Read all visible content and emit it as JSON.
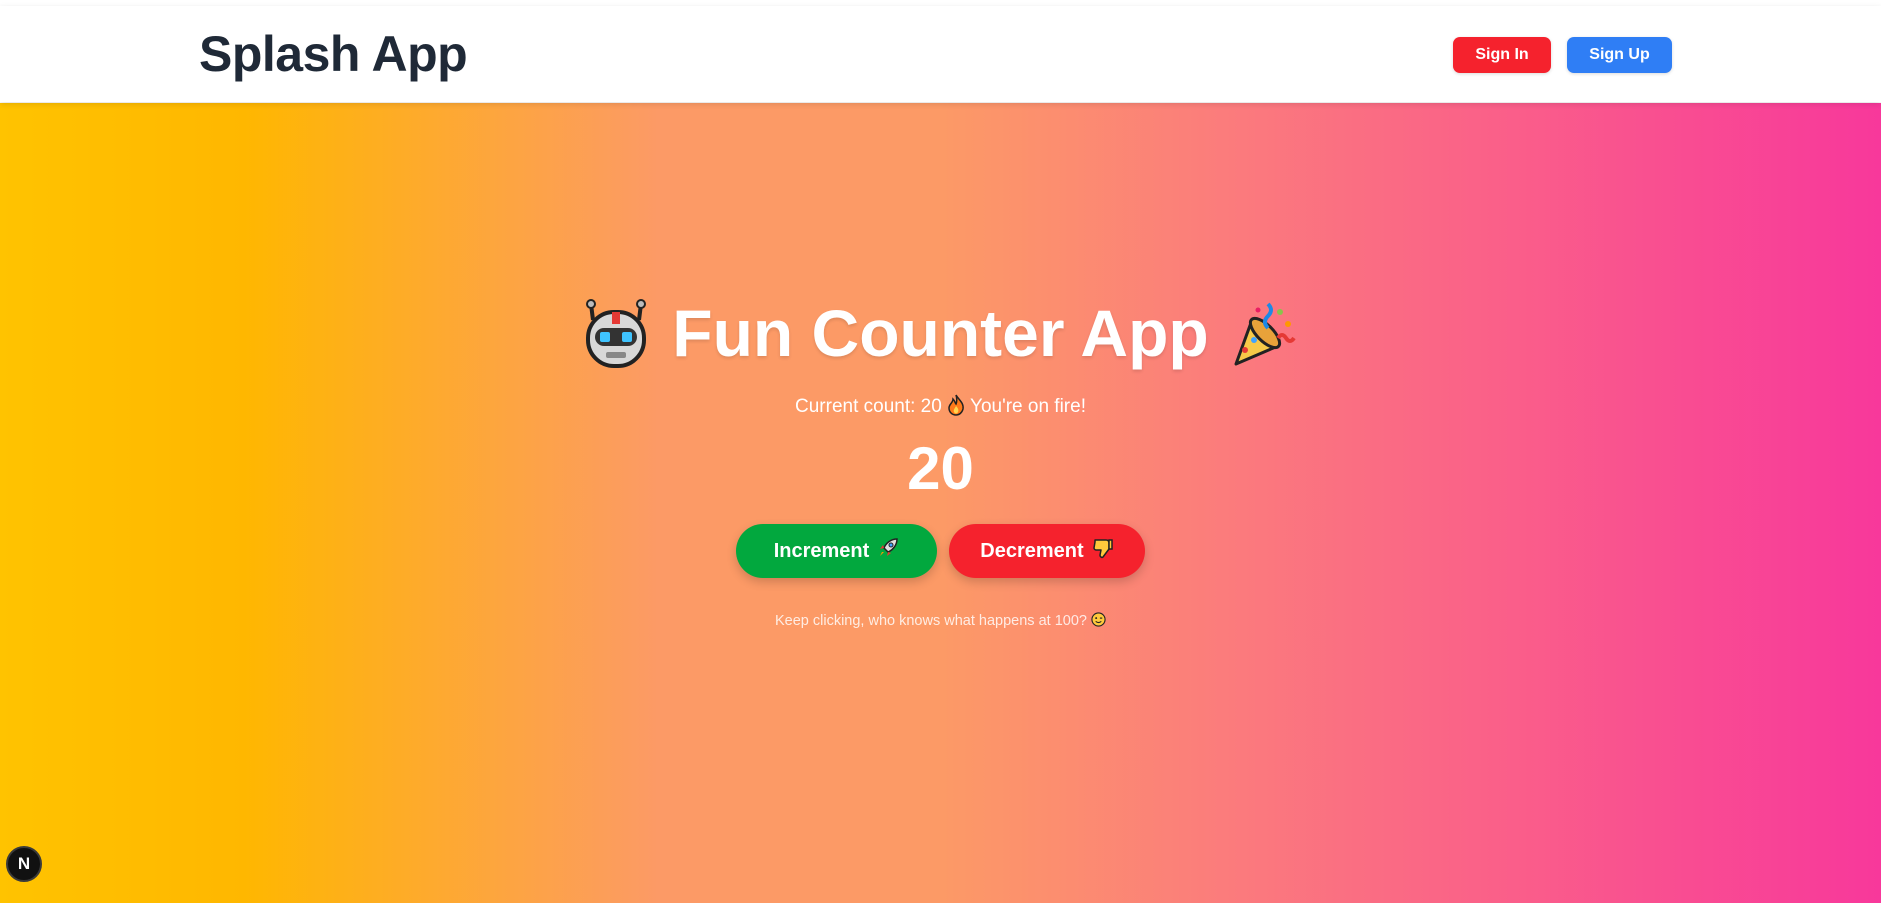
{
  "header": {
    "brand": "Splash App",
    "sign_in_label": "Sign In",
    "sign_up_label": "Sign Up",
    "sign_in_color": "#f5222d",
    "sign_up_color": "#2f7ef5"
  },
  "hero": {
    "title": "Fun Counter App",
    "left_emoji_icon": "robot-icon",
    "right_emoji_icon": "party-popper-icon",
    "subtitle_prefix": "Current count: 20",
    "subtitle_suffix": "You're on fire!",
    "subtitle_icon": "fire-icon",
    "count": "20",
    "increment_label": "Increment",
    "increment_icon": "rocket-icon",
    "decrement_label": "Decrement",
    "decrement_icon": "thumbs-down-icon",
    "increment_color": "#02a83e",
    "decrement_color": "#f5222d",
    "hint_text": "Keep clicking, who knows what happens at 100?",
    "hint_icon": "winking-face-icon"
  },
  "background": {
    "gradient_start": "#ffc300",
    "gradient_mid": "#fc9a66",
    "gradient_end": "#f8389b"
  },
  "dev_badge": {
    "label": "N"
  }
}
